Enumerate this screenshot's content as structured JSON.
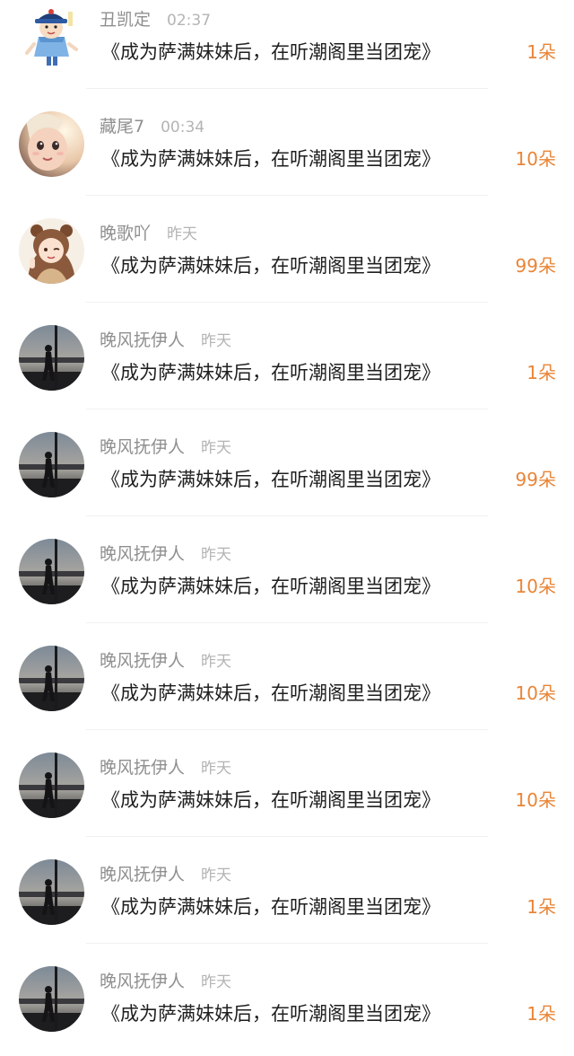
{
  "colors": {
    "username": "#8f8f8f",
    "time": "#b4b4b4",
    "title": "#1f1f1f",
    "gift_count": "#e98537",
    "divider": "#f1f1f1"
  },
  "items": [
    {
      "avatar_icon": "cartoon-qing-official-avatar",
      "username": "丑凯定",
      "time": "02:37",
      "book_title": "《成为萨满妹妹后，在听潮阁里当团宠》",
      "gift_count": "1朵"
    },
    {
      "avatar_icon": "girl-face-avatar",
      "username": "藏尾7",
      "time": "00:34",
      "book_title": "《成为萨满妹妹后，在听潮阁里当团宠》",
      "gift_count": "10朵"
    },
    {
      "avatar_icon": "anime-girl-bear-ears-avatar",
      "username": "晚歌吖",
      "time": "昨天",
      "book_title": "《成为萨满妹妹后，在听潮阁里当团宠》",
      "gift_count": "99朵"
    },
    {
      "avatar_icon": "dusk-silhouette-photo-avatar",
      "username": "晚风抚伊人",
      "time": "昨天",
      "book_title": "《成为萨满妹妹后，在听潮阁里当团宠》",
      "gift_count": "1朵"
    },
    {
      "avatar_icon": "dusk-silhouette-photo-avatar",
      "username": "晚风抚伊人",
      "time": "昨天",
      "book_title": "《成为萨满妹妹后，在听潮阁里当团宠》",
      "gift_count": "99朵"
    },
    {
      "avatar_icon": "dusk-silhouette-photo-avatar",
      "username": "晚风抚伊人",
      "time": "昨天",
      "book_title": "《成为萨满妹妹后，在听潮阁里当团宠》",
      "gift_count": "10朵"
    },
    {
      "avatar_icon": "dusk-silhouette-photo-avatar",
      "username": "晚风抚伊人",
      "time": "昨天",
      "book_title": "《成为萨满妹妹后，在听潮阁里当团宠》",
      "gift_count": "10朵"
    },
    {
      "avatar_icon": "dusk-silhouette-photo-avatar",
      "username": "晚风抚伊人",
      "time": "昨天",
      "book_title": "《成为萨满妹妹后，在听潮阁里当团宠》",
      "gift_count": "10朵"
    },
    {
      "avatar_icon": "dusk-silhouette-photo-avatar",
      "username": "晚风抚伊人",
      "time": "昨天",
      "book_title": "《成为萨满妹妹后，在听潮阁里当团宠》",
      "gift_count": "1朵"
    },
    {
      "avatar_icon": "dusk-silhouette-photo-avatar",
      "username": "晚风抚伊人",
      "time": "昨天",
      "book_title": "《成为萨满妹妹后，在听潮阁里当团宠》",
      "gift_count": "1朵"
    }
  ]
}
